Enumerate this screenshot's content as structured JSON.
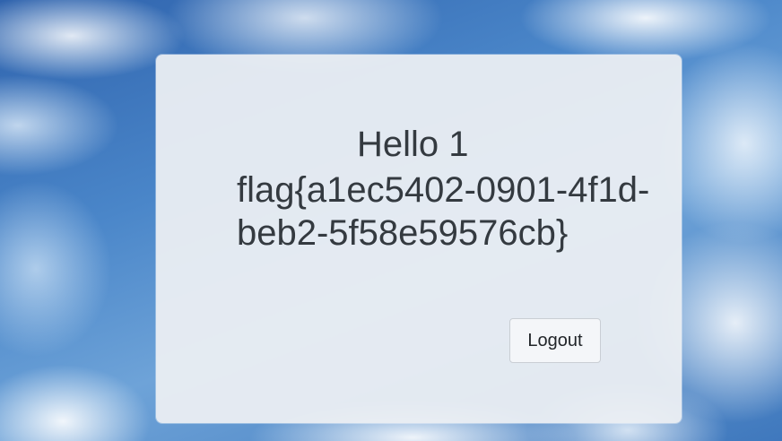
{
  "greeting": "Hello 1",
  "flag": {
    "line1": "flag{a1ec5402-0901-4f1d-",
    "line2": "beb2-5f58e59576cb}"
  },
  "logout_label": "Logout",
  "colors": {
    "panel_background": "#eceff3",
    "text": "#343a40",
    "sky": "#4f86c4"
  }
}
